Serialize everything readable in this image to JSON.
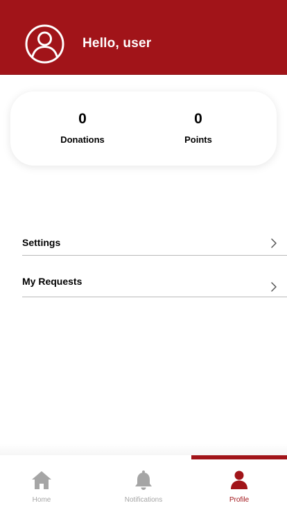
{
  "header": {
    "greeting": "Hello, user",
    "avatar_icon": "user-circle-icon",
    "background_color": "#a11419"
  },
  "stats": {
    "donations": {
      "value": "0",
      "label": "Donations"
    },
    "points": {
      "value": "0",
      "label": "Points"
    }
  },
  "menu": {
    "items": [
      {
        "label": "Settings",
        "icon": "chevron-right-icon"
      },
      {
        "label": "My Requests",
        "icon": "chevron-right-icon"
      }
    ]
  },
  "tabbar": {
    "tabs": [
      {
        "label": "Home",
        "icon": "home-icon",
        "active": false
      },
      {
        "label": "Notifications",
        "icon": "bell-icon",
        "active": false
      },
      {
        "label": "Profile",
        "icon": "person-icon",
        "active": true
      }
    ],
    "active_color": "#a11419",
    "inactive_color": "#a5a5a5"
  }
}
